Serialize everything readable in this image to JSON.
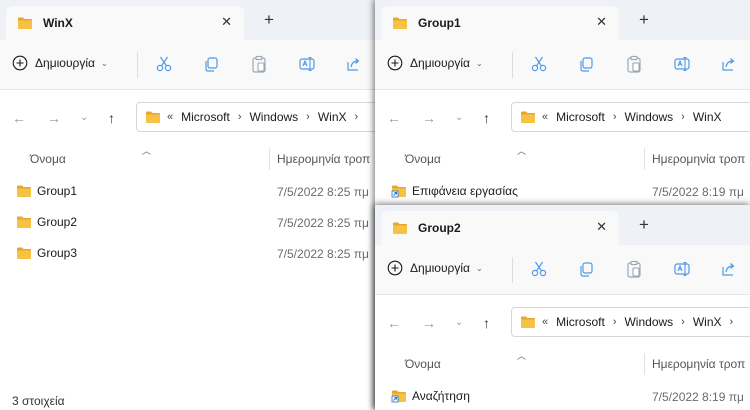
{
  "icons": {
    "folder": "folder-icon",
    "shortcut": "shortcut-folder-icon"
  },
  "colors": {
    "folder_yellow": "#f6c244",
    "tabbar": "#eef1f5",
    "accent": "#005fb8"
  },
  "w1": {
    "tab_title": "WinX",
    "close": "✕",
    "newtab": "+",
    "create_label": "Δημιουργία",
    "path": {
      "chevrons": "«",
      "items": [
        "Microsoft",
        "Windows",
        "WinX"
      ]
    },
    "columns": {
      "name": "Όνομα",
      "date": "Ημερομηνία τροπ"
    },
    "rows": [
      {
        "name": "Group1",
        "date": "7/5/2022 8:25 πμ"
      },
      {
        "name": "Group2",
        "date": "7/5/2022 8:25 πμ"
      },
      {
        "name": "Group3",
        "date": "7/5/2022 8:25 πμ"
      }
    ],
    "status": "3 στοιχεία"
  },
  "w2": {
    "tab_title": "Group1",
    "close": "✕",
    "newtab": "+",
    "create_label": "Δημιουργία",
    "path": {
      "chevrons": "«",
      "items": [
        "Microsoft",
        "Windows",
        "WinX"
      ]
    },
    "columns": {
      "name": "Όνομα",
      "date": "Ημερομηνία τροπ"
    },
    "rows": [
      {
        "name": "Επιφάνεια εργασίας",
        "date": "7/5/2022 8:19 πμ"
      }
    ]
  },
  "w3": {
    "tab_title": "Group2",
    "close": "✕",
    "newtab": "+",
    "create_label": "Δημιουργία",
    "path": {
      "chevrons": "«",
      "items": [
        "Microsoft",
        "Windows",
        "WinX"
      ]
    },
    "columns": {
      "name": "Όνομα",
      "date": "Ημερομηνία τροπ"
    },
    "rows": [
      {
        "name": "Αναζήτηση",
        "date": "7/5/2022 8:19 πμ"
      }
    ]
  }
}
